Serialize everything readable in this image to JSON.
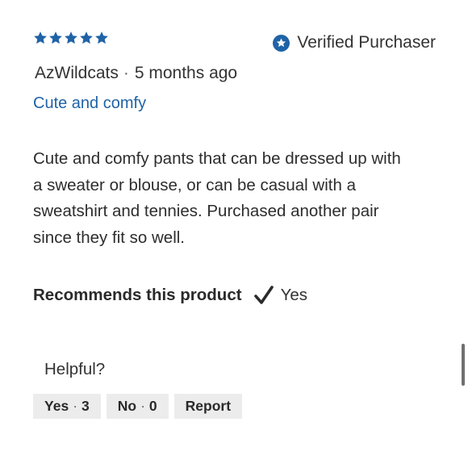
{
  "review": {
    "rating": 5,
    "rating_max": 5,
    "star_color": "#1f63a6",
    "verified_label": "Verified Purchaser",
    "verified_icon": "star-badge-icon",
    "author": "AzWildcats",
    "separator": "·",
    "time_ago": "5 months ago",
    "title": "Cute and comfy",
    "body": "Cute and comfy pants that can be dressed up with a sweater or blouse, or can be casual with a sweatshirt and tennies. Purchased another pair since they fit so well.",
    "recommend_label": "Recommends this product",
    "recommend_icon": "checkmark-icon",
    "recommend_value": "Yes"
  },
  "feedback": {
    "helpful_label": "Helpful?",
    "yes_label": "Yes",
    "yes_count": "3",
    "no_label": "No",
    "no_count": "0",
    "report_label": "Report",
    "separator": "·"
  }
}
